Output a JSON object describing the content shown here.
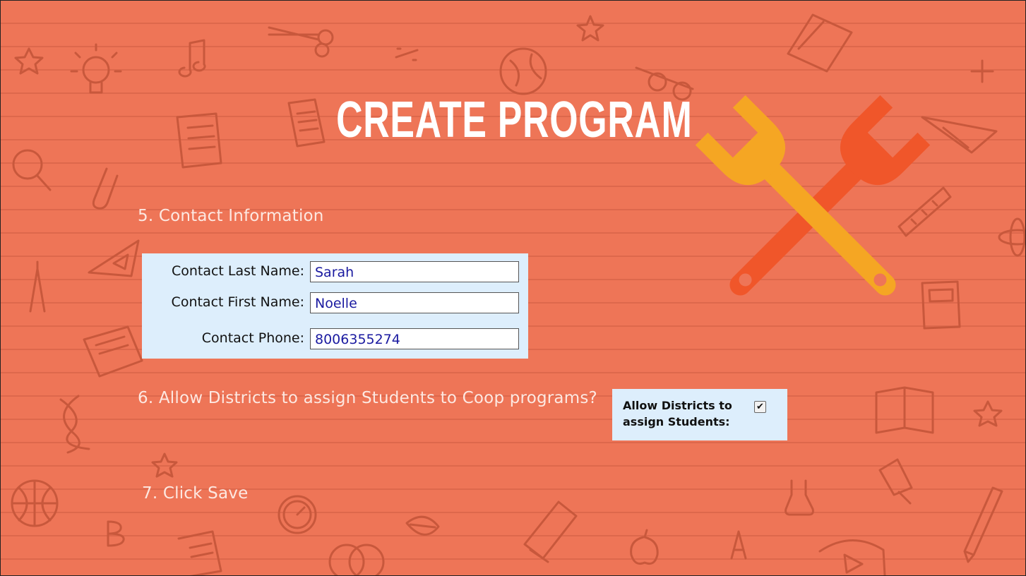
{
  "title": "CREATE PROGRAM",
  "steps": {
    "step5": "5.  Contact Information",
    "step6": "6.  Allow Districts to assign Students to Coop programs?",
    "step7": "7.   Click Save"
  },
  "contact_form": {
    "last_name_label": "Contact Last Name:",
    "last_name_value": "Sarah",
    "first_name_label": "Contact First Name:",
    "first_name_value": "Noelle",
    "phone_label": "Contact Phone:",
    "phone_value": "8006355274"
  },
  "allow_districts": {
    "label_line1": "Allow Districts to",
    "label_line2": "assign Students:",
    "checked": true,
    "check_glyph": "✔"
  },
  "colors": {
    "background": "#ee7557",
    "wrench_orange": "#f0562a",
    "wrench_yellow": "#f5a623",
    "panel": "#ddeefc"
  },
  "icons": [
    "wrench-icon",
    "lightbulb-icon",
    "scissors-icon",
    "globe-icon",
    "notebook-icon",
    "magnifier-icon",
    "paperclip-icon",
    "compass-icon",
    "calculator-icon",
    "book-icon",
    "apple-icon",
    "basketball-icon",
    "clock-icon",
    "flask-icon",
    "pushpin-icon",
    "pencil-icon",
    "star-icon",
    "music-note-icon",
    "paper-plane-icon",
    "ruler-icon",
    "dna-icon",
    "leaf-icon"
  ]
}
